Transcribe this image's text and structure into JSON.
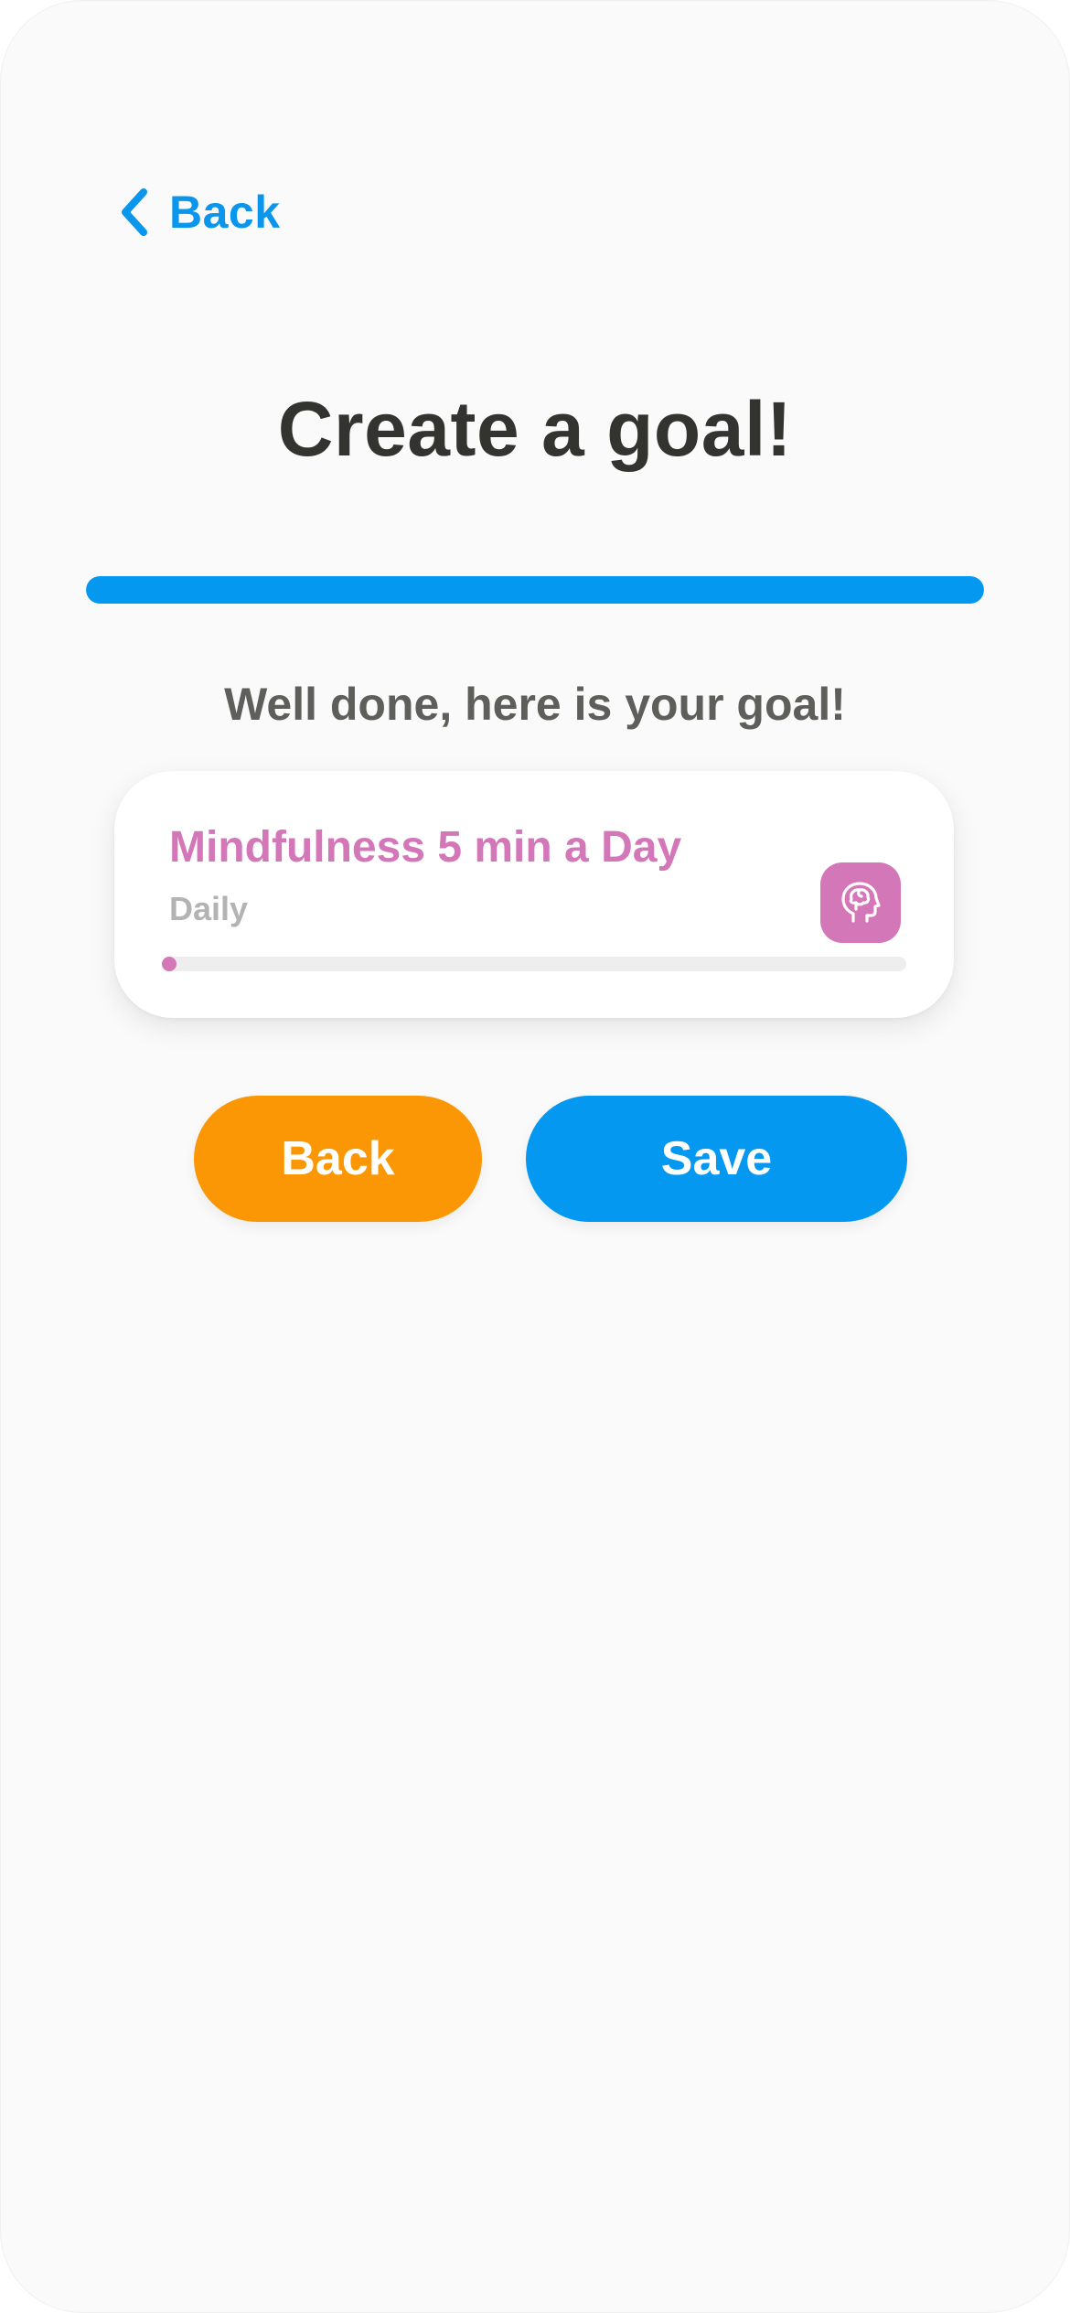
{
  "nav": {
    "back_label": "Back"
  },
  "page": {
    "title": "Create a goal!",
    "progress": 1.0,
    "subtitle": "Well done, here is your goal!"
  },
  "goal_card": {
    "title": "Mindfulness 5 min a Day",
    "frequency": "Daily",
    "icon": "mindfulness-head-icon",
    "progress": 0.0
  },
  "actions": {
    "back_label": "Back",
    "save_label": "Save"
  },
  "colors": {
    "primary_blue": "#0598f0",
    "accent_orange": "#fb9705",
    "goal_pink": "#d477b8",
    "title_dark": "#33332f",
    "background": "#fafafa"
  }
}
